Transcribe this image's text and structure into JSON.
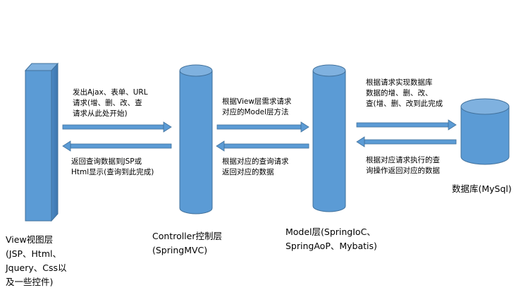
{
  "colors": {
    "fill": "#5b9bd5",
    "stroke": "#41719c",
    "arrow": "#5b9bd5"
  },
  "nodes": {
    "view": {
      "label": "View视图层\n(JSP、Html、\nJquery、Css以\n及一些控件)"
    },
    "controller": {
      "label": "Controller控制层\n(SpringMVC)"
    },
    "model": {
      "label": "Model层(SpringIoC、\nSpringAoP、Mybatis)"
    },
    "database": {
      "label": "数据库(MySql)"
    }
  },
  "edges": {
    "view_to_controller": "发出Ajax、表单、URL\n请求(增、删、改、查\n请求从此处开始)",
    "controller_to_view": "返回查询数据到JSP或\nHtml显示(查询到此完成)",
    "controller_to_model": "根据View层需求请求\n对应的Model层方法",
    "model_to_controller": "根据对应的查询请求\n返回对应的数据",
    "model_to_db": "根据请求实现数据库\n数据的增、删、改、\n查(增、删、改到此完成",
    "db_to_model": "根据对应请求执行的查\n询操作返回对应的数据"
  }
}
